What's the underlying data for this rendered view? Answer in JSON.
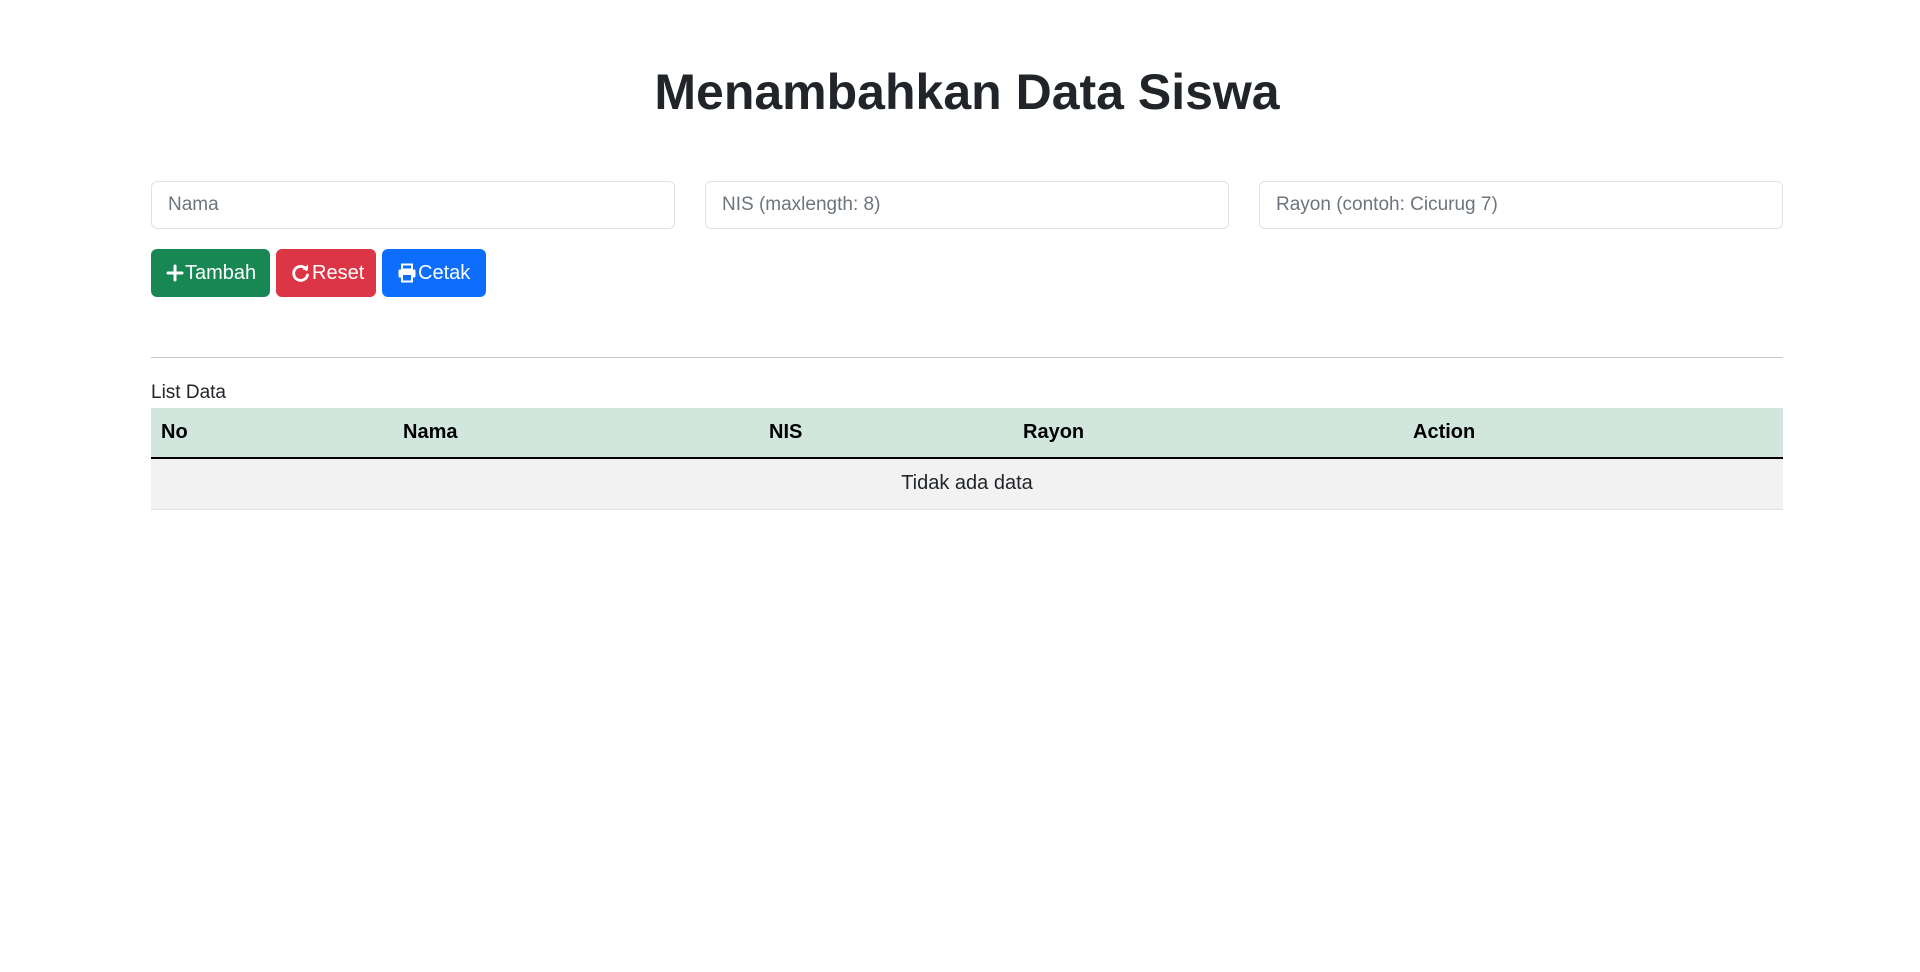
{
  "page": {
    "title": "Menambahkan Data Siswa"
  },
  "form": {
    "nama_placeholder": "Nama",
    "nis_placeholder": "NIS (maxlength: 8)",
    "rayon_placeholder": "Rayon (contoh: Cicurug 7)",
    "nama_value": "",
    "nis_value": "",
    "rayon_value": ""
  },
  "buttons": {
    "tambah": {
      "label": "Tambah",
      "icon": "plus-icon",
      "color": "#198754"
    },
    "reset": {
      "label": "Reset",
      "icon": "refresh-icon",
      "color": "#dc3545"
    },
    "cetak": {
      "label": "Cetak",
      "icon": "printer-icon",
      "color": "#0d6efd"
    }
  },
  "list": {
    "label": "List Data",
    "columns": [
      "No",
      "Nama",
      "NIS",
      "Rayon",
      "Action"
    ],
    "empty_message": "Tidak ada data",
    "header_color": "#d1e7dd"
  }
}
